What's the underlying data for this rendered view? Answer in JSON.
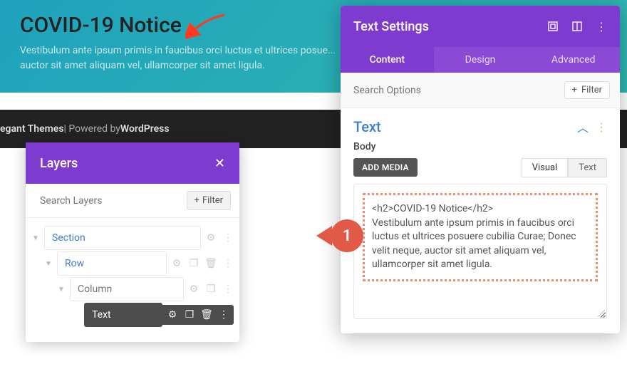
{
  "hero": {
    "title": "COVID-19 Notice",
    "body": "Vestibulum ante ipsum primis in faucibus orci luctus et ultrices posue... auctor sit amet aliquam vel, ullamcorper sit amet ligula."
  },
  "footer": {
    "theme_label": "egant Themes",
    "sep": " | Powered by ",
    "platform": "WordPress"
  },
  "layers": {
    "title": "Layers",
    "search_placeholder": "Search Layers",
    "filter_label": "Filter",
    "items": {
      "section": "Section",
      "row": "Row",
      "column": "Column",
      "text": "Text"
    }
  },
  "settings": {
    "title": "Text Settings",
    "tabs": {
      "content": "Content",
      "design": "Design",
      "advanced": "Advanced"
    },
    "search_placeholder": "Search Options",
    "filter_label": "Filter",
    "section_title": "Text",
    "body_label": "Body",
    "add_media": "ADD MEDIA",
    "editor_tabs": {
      "visual": "Visual",
      "text": "Text"
    },
    "code": "<h2>COVID-19 Notice</h2>\nVestibulum ante ipsum primis in faucibus orci luctus et ultrices posuere cubilia Curae; Donec velit neque, auctor sit amet aliquam vel, ullamcorper sit amet ligula."
  },
  "annotation": {
    "num": "1"
  }
}
